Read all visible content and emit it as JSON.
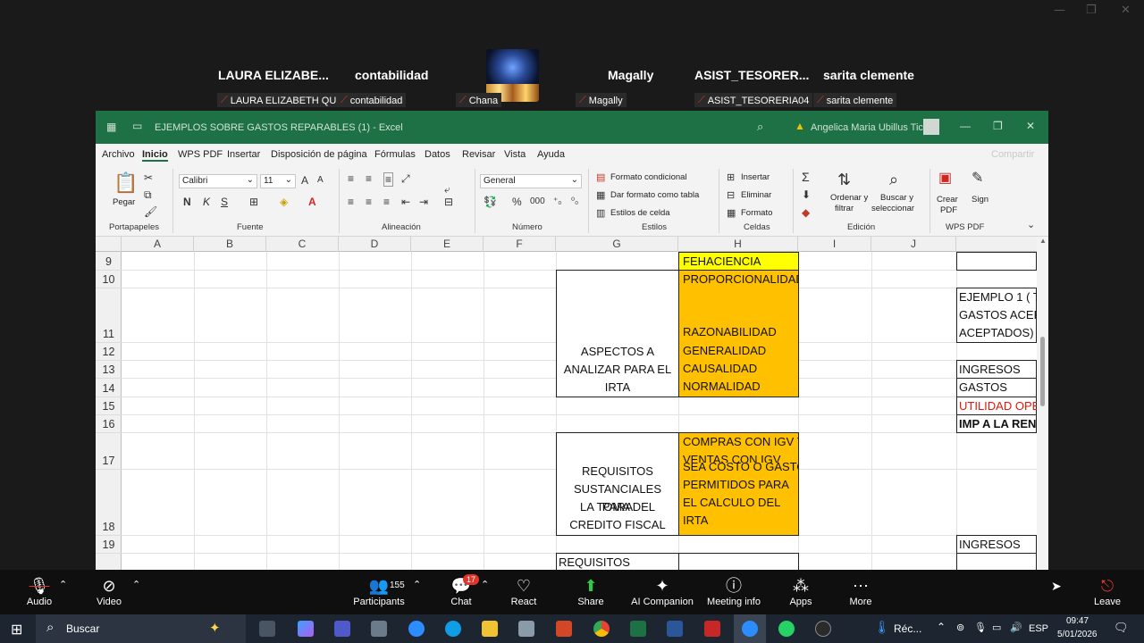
{
  "participants": [
    {
      "name": "LAURA  ELIZABE...",
      "tag": "LAURA ELIZABETH QUI..."
    },
    {
      "name": "contabilidad",
      "tag": "contabilidad"
    },
    {
      "name": "",
      "tag": "Chana"
    },
    {
      "name": "Magally",
      "tag": "Magally"
    },
    {
      "name": "ASIST_TESORER...",
      "tag": "ASIST_TESORERIA04"
    },
    {
      "name": "sarita clemente",
      "tag": "sarita clemente"
    }
  ],
  "excel": {
    "title": "EJEMPLOS SOBRE GASTOS REPARABLES (1)  -  Excel",
    "search_placeholder": "",
    "user": "Angelica Maria Ubillus Ticlla",
    "share_label": "Compartir",
    "menu": [
      "Archivo",
      "Inicio",
      "WPS PDF",
      "Insertar",
      "Disposición de página",
      "Fórmulas",
      "Datos",
      "Revisar",
      "Vista",
      "Ayuda"
    ],
    "ribbon": {
      "paste": "Pegar",
      "font_name": "Calibri",
      "font_size": "11",
      "bold": "N",
      "italic": "K",
      "underline": "S",
      "number_format": "General",
      "cond_format": "Formato condicional",
      "table_format": "Dar formato como tabla",
      "cell_styles": "Estilos de celda",
      "insert": "Insertar",
      "delete": "Eliminar",
      "format": "Formato",
      "sort_1": "Ordenar y",
      "sort_2": "filtrar",
      "find_1": "Buscar y",
      "find_2": "seleccionar",
      "create_pdf_1": "Crear",
      "create_pdf_2": "PDF",
      "sign": "Sign",
      "groups": {
        "clipboard": "Portapapeles",
        "font": "Fuente",
        "alignment": "Alineación",
        "number": "Número",
        "styles": "Estilos",
        "cells": "Celdas",
        "editing": "Edición",
        "wps": "WPS PDF"
      }
    },
    "columns": [
      "A",
      "B",
      "C",
      "D",
      "E",
      "F",
      "G",
      "H",
      "I",
      "J"
    ],
    "rows": [
      "9",
      "10",
      "11",
      "12",
      "13",
      "14",
      "15",
      "16",
      "17",
      "18",
      "19"
    ],
    "cells": {
      "h9": "FEHACIENCIA",
      "h10": "PROPORCIONALIDAD",
      "h11": "RAZONABILIDAD",
      "h12": "GENERALIDAD",
      "h13": "CAUSALIDAD",
      "h14": "NORMALIDAD",
      "g_aspectos_1": "ASPECTOS A",
      "g_aspectos_2": "ANALIZAR PARA EL",
      "g_aspectos_3": "IRTA",
      "h17_1": "COMPRAS CON IGV Y",
      "h17_2": "VENTAS CON IGV",
      "h18_1": "SEA COSTO O GASTO",
      "h18_2": "PERMITIDOS PARA",
      "h18_3": "EL CALCULO DEL",
      "h18_4": "IRTA",
      "g_req_1": "REQUISITOS",
      "g_req_2": "SUSTANCIALES PARA",
      "g_req_3": "LA TOMA DEL",
      "g_req_4": "CREDITO FISCAL",
      "g_req_next": "REQUISITOS",
      "k11_1": "EJEMPLO 1 ( T",
      "k11_2": "GASTOS ACEP",
      "k11_3": "ACEPTADOS)",
      "k13": "INGRESOS",
      "k14": "GASTOS",
      "k15": "UTILIDAD OPE",
      "k16": "IMP A LA REN",
      "k19": "INGRESOS"
    }
  },
  "zoom_bar": {
    "audio": "Audio",
    "video": "Video",
    "participants": "Participants",
    "participant_count": "155",
    "chat": "Chat",
    "chat_badge": "17",
    "react": "React",
    "share": "Share",
    "ai_companion": "AI Companion",
    "meeting_info": "Meeting info",
    "apps": "Apps",
    "more": "More",
    "leave": "Leave"
  },
  "taskbar": {
    "search_placeholder": "Buscar",
    "weather": "Réc...",
    "language": "ESP",
    "time": "09:47",
    "date": "5/01/2026"
  },
  "colors": {
    "excel_green": "#1e7145",
    "yellow": "#ffff00",
    "orange": "#ffc000",
    "zoom_share": "#2ecc40",
    "leave_red": "#e0352b"
  }
}
